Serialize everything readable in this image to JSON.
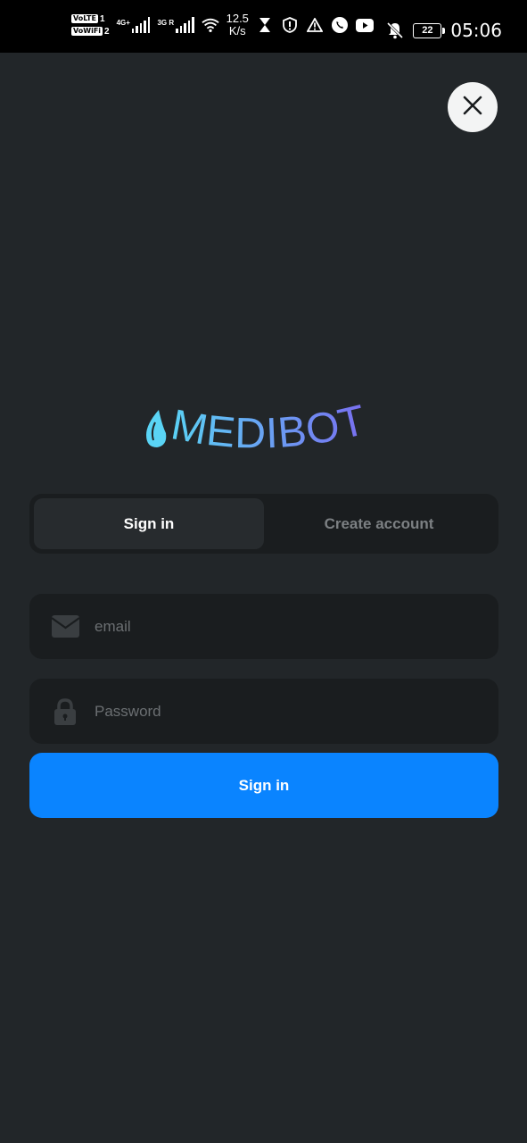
{
  "status_bar": {
    "sim1_tag": "VoLTE",
    "sim1_num": "1",
    "sim2_tag": "VoWiFi",
    "sim2_num": "2",
    "net1": "4G+",
    "net2": "3G R",
    "speed_value": "12.5",
    "speed_unit": "K/s",
    "battery": "22",
    "time": "05:06"
  },
  "logo": {
    "text": "MEDIBOT",
    "gradient_start": "#5ad4f5",
    "gradient_end": "#7a6bf0"
  },
  "tabs": {
    "sign_in": "Sign in",
    "create_account": "Create account"
  },
  "form": {
    "email_placeholder": "email",
    "password_placeholder": "Password",
    "submit_label": "Sign in"
  },
  "colors": {
    "background": "#222629",
    "field_bg": "#1a1d1f",
    "primary": "#0a84ff"
  }
}
